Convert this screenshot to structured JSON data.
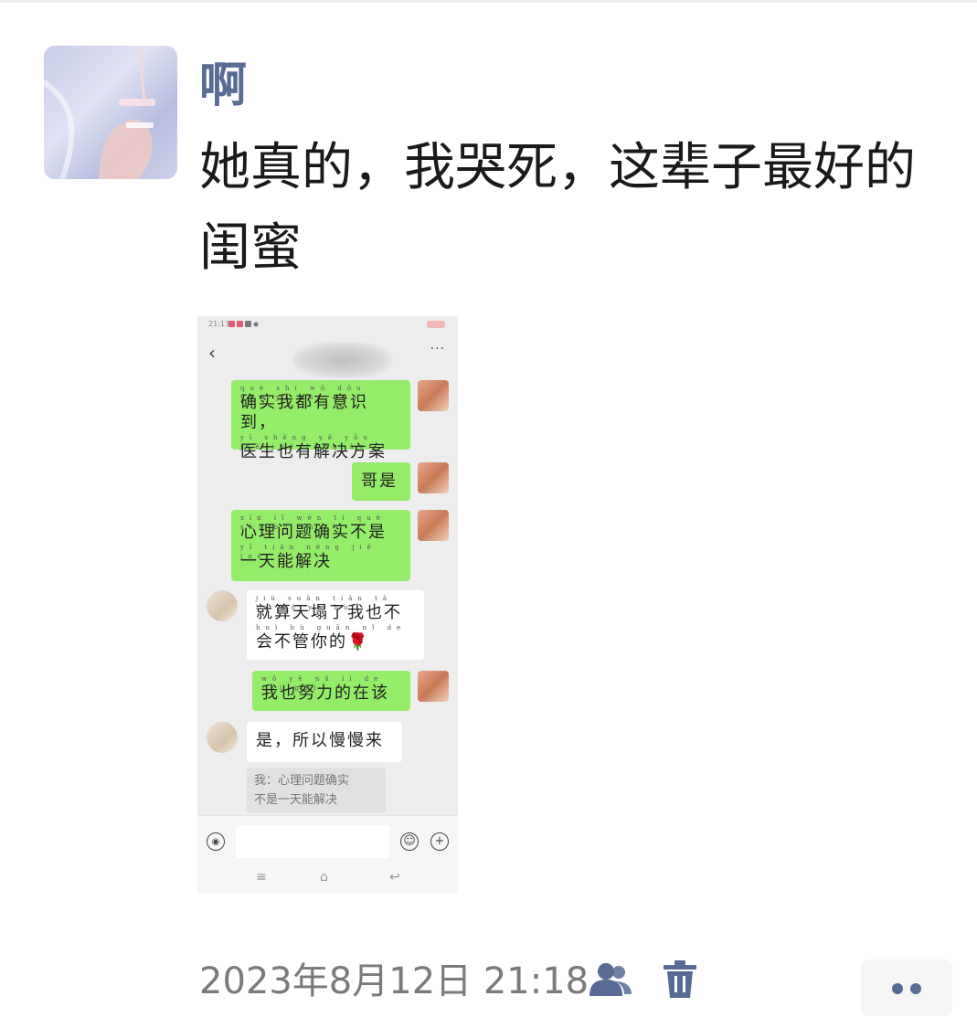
{
  "post": {
    "author": "啊",
    "text": "她真的，我哭死，这辈子最好的闺蜜",
    "timestamp": "2023年8月12日 21:18"
  },
  "screenshot": {
    "status_time": "21:13",
    "messages": [
      {
        "side": "me",
        "pinyin": [
          "què shí wǒ dōu yǒu yì shí dào",
          "yī shēng yě yǒu jiě jué fāng àn"
        ],
        "lines": [
          "确实我都有意识到，",
          "医生也有解决方案"
        ]
      },
      {
        "side": "me",
        "pinyin": [],
        "lines": [
          "哥是"
        ]
      },
      {
        "side": "me",
        "pinyin": [
          "xīn lǐ wèn tí què shí bù shì",
          "yī tiān néng jiě jué"
        ],
        "lines": [
          "心理问题确实不是",
          "一天能解决"
        ]
      },
      {
        "side": "her",
        "pinyin": [
          "jiù suàn tiān tā le wǒ yě bù",
          "huì bù guǎn nǐ de"
        ],
        "lines": [
          "就算天塌了我也不",
          "会不管你的🌹"
        ]
      },
      {
        "side": "me",
        "pinyin": [
          "wǒ yě nǔ lì de zài gāi"
        ],
        "lines": [
          "我也努力的在该"
        ]
      },
      {
        "side": "her",
        "pinyin": [],
        "lines": [
          "是，所以慢慢来"
        ]
      }
    ],
    "quote_lines": [
      "我：心理问题确实",
      "不是一天能解决"
    ]
  },
  "icons": {
    "voice": "voice-icon",
    "emoji": "emoji-icon",
    "plus": "plus-icon",
    "visibility": "people-icon",
    "delete": "trash-icon",
    "more": "more-dots-icon"
  },
  "colors": {
    "link_blue": "#576b95",
    "bubble_green": "#95ec69",
    "timestamp_gray": "#7a7a7a"
  }
}
